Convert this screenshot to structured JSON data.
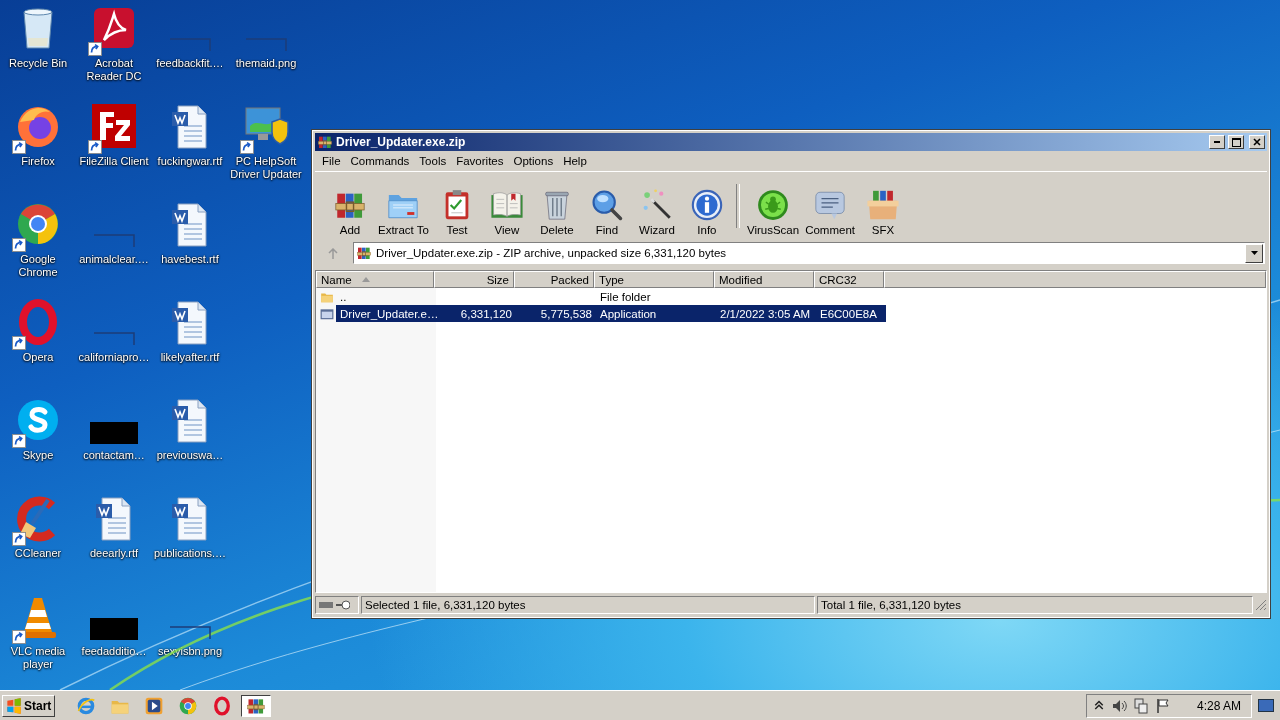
{
  "desktop": {
    "icons": [
      {
        "label": "Recycle Bin",
        "kind": "recycle",
        "shortcut": false
      },
      {
        "label": "Firefox",
        "kind": "firefox",
        "shortcut": true
      },
      {
        "label": "Google Chrome",
        "kind": "chrome",
        "shortcut": true
      },
      {
        "label": "Opera",
        "kind": "opera",
        "shortcut": true
      },
      {
        "label": "Skype",
        "kind": "skype",
        "shortcut": true
      },
      {
        "label": "CCleaner",
        "kind": "ccleaner",
        "shortcut": true
      },
      {
        "label": "VLC media player",
        "kind": "vlc",
        "shortcut": true
      },
      {
        "label": "Acrobat Reader DC",
        "kind": "pdf",
        "shortcut": true
      },
      {
        "label": "FileZilla Client",
        "kind": "filezilla",
        "shortcut": true
      },
      {
        "label": "animalclear.…",
        "kind": "blank",
        "shortcut": false
      },
      {
        "label": "californiapro…",
        "kind": "blank",
        "shortcut": false
      },
      {
        "label": "contactam…",
        "kind": "black",
        "shortcut": false
      },
      {
        "label": "deearly.rtf",
        "kind": "word",
        "shortcut": false
      },
      {
        "label": "feedadditio…",
        "kind": "black",
        "shortcut": false
      },
      {
        "label": "feedbackfit.…",
        "kind": "blank",
        "shortcut": false
      },
      {
        "label": "fuckingwar.rtf",
        "kind": "word",
        "shortcut": false
      },
      {
        "label": "havebest.rtf",
        "kind": "word",
        "shortcut": false
      },
      {
        "label": "likelyafter.rtf",
        "kind": "word",
        "shortcut": false
      },
      {
        "label": "previouswa…",
        "kind": "word",
        "shortcut": false
      },
      {
        "label": "publications.…",
        "kind": "word",
        "shortcut": false
      },
      {
        "label": "sexyisbn.png",
        "kind": "blank",
        "shortcut": false
      },
      {
        "label": "themaid.png",
        "kind": "blank",
        "shortcut": false
      },
      {
        "label": "PC HelpSoft Driver Updater",
        "kind": "updater",
        "shortcut": true
      }
    ]
  },
  "window": {
    "title": "Driver_Updater.exe.zip",
    "menu": [
      "File",
      "Commands",
      "Tools",
      "Favorites",
      "Options",
      "Help"
    ],
    "toolbar": [
      {
        "label": "Add",
        "kind": "add"
      },
      {
        "label": "Extract To",
        "kind": "extract"
      },
      {
        "label": "Test",
        "kind": "test"
      },
      {
        "label": "View",
        "kind": "view"
      },
      {
        "label": "Delete",
        "kind": "delete"
      },
      {
        "label": "Find",
        "kind": "find"
      },
      {
        "label": "Wizard",
        "kind": "wizard"
      },
      {
        "label": "Info",
        "kind": "info"
      },
      {
        "label": "VirusScan",
        "kind": "virusscan"
      },
      {
        "label": "Comment",
        "kind": "comment"
      },
      {
        "label": "SFX",
        "kind": "sfx"
      }
    ],
    "address": "Driver_Updater.exe.zip - ZIP archive, unpacked size 6,331,120 bytes",
    "columns": [
      {
        "label": "Name",
        "sorted": true
      },
      {
        "label": "Size",
        "sorted": false
      },
      {
        "label": "Packed",
        "sorted": false
      },
      {
        "label": "Type",
        "sorted": false
      },
      {
        "label": "Modified",
        "sorted": false
      },
      {
        "label": "CRC32",
        "sorted": false
      }
    ],
    "rows": [
      {
        "kind": "folder",
        "name": "..",
        "size": "",
        "packed": "",
        "type": "File folder",
        "modified": "",
        "crc32": "",
        "selected": false
      },
      {
        "kind": "file",
        "name": "Driver_Updater.e…",
        "size": "6,331,120",
        "packed": "5,775,538",
        "type": "Application",
        "modified": "2/1/2022 3:05 AM",
        "crc32": "E6C00E8A",
        "selected": true
      }
    ],
    "status_left": "Selected 1 file, 6,331,120 bytes",
    "status_right": "Total 1 file, 6,331,120 bytes"
  },
  "taskbar": {
    "start": "Start",
    "items": [
      {
        "kind": "ie",
        "selected": false
      },
      {
        "kind": "explorer",
        "selected": false
      },
      {
        "kind": "player",
        "selected": false
      },
      {
        "kind": "chrome",
        "selected": false
      },
      {
        "kind": "opera",
        "selected": false
      },
      {
        "kind": "winrar",
        "selected": true
      }
    ],
    "tray": [
      {
        "kind": "chevron"
      },
      {
        "kind": "speaker"
      },
      {
        "kind": "network"
      },
      {
        "kind": "flag"
      }
    ],
    "clock": "4:28 AM"
  }
}
